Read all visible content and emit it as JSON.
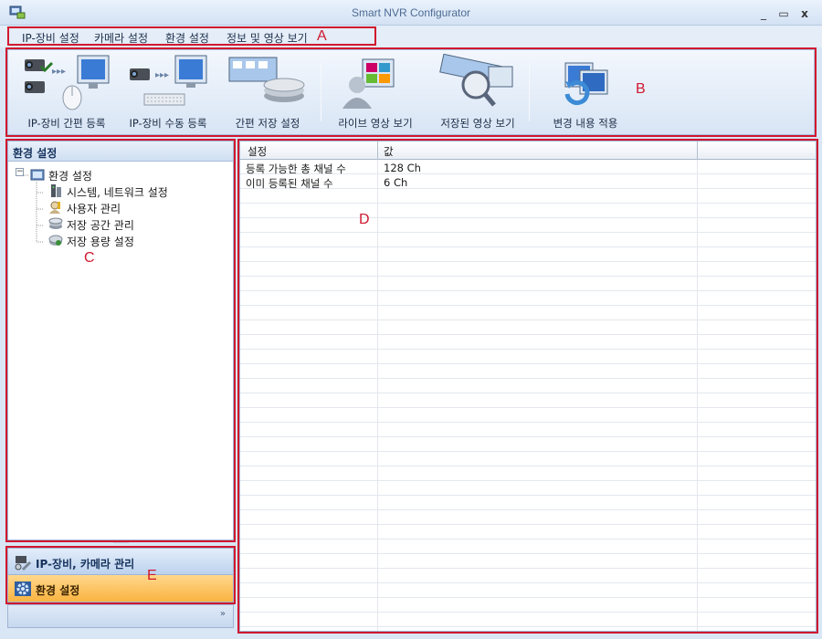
{
  "window": {
    "title": "Smart NVR Configurator",
    "minimize_glyph": "_",
    "maximize_glyph": "▭",
    "close_glyph": "x"
  },
  "menu": [
    "IP-장비 설정",
    "카메라 설정",
    "환경 설정",
    "정보 및 영상 보기"
  ],
  "ribbon": {
    "buttons": [
      {
        "label": "IP-장비 간편 등록",
        "icon": "camera-auto-register-icon"
      },
      {
        "label": "IP-장비 수동 등록",
        "icon": "camera-manual-register-icon"
      },
      {
        "label": "간편 저장 설정",
        "icon": "storage-setup-icon"
      },
      {
        "label": "라이브 영상 보기",
        "icon": "live-view-icon"
      },
      {
        "label": "저장된 영상 보기",
        "icon": "playback-icon"
      },
      {
        "label": "변경 내용 적용",
        "icon": "apply-changes-icon"
      }
    ]
  },
  "left_panel": {
    "header": "환경 설정",
    "tree": {
      "root": {
        "label": "환경 설정",
        "icon": "settings-folder-icon",
        "expander": "−"
      },
      "children": [
        {
          "label": "시스템, 네트워크 설정",
          "icon": "system-network-icon"
        },
        {
          "label": "사용자 관리",
          "icon": "user-key-icon"
        },
        {
          "label": "저장 공간 관리",
          "icon": "storage-disk-icon"
        },
        {
          "label": "저장 용량 설정",
          "icon": "storage-capacity-icon"
        }
      ]
    }
  },
  "nav": {
    "items": [
      {
        "label": "IP-장비, 카메라 관리",
        "icon": "device-tools-icon",
        "selected": false
      },
      {
        "label": "환경 설정",
        "icon": "gear-settings-icon",
        "selected": true
      }
    ],
    "more_glyph": "»"
  },
  "grid": {
    "columns": [
      "설정",
      "값"
    ],
    "rows": [
      {
        "setting": "등록 가능한 총 채널 수",
        "value": "128 Ch"
      },
      {
        "setting": "이미 등록된 채널 수",
        "value": "6 Ch"
      }
    ]
  },
  "annotations": [
    "A",
    "B",
    "C",
    "D",
    "E"
  ],
  "colors": {
    "annotation_red": "#d0182f",
    "selected_nav": "#f9b340",
    "ribbon_bg": "#d8e5f5"
  }
}
